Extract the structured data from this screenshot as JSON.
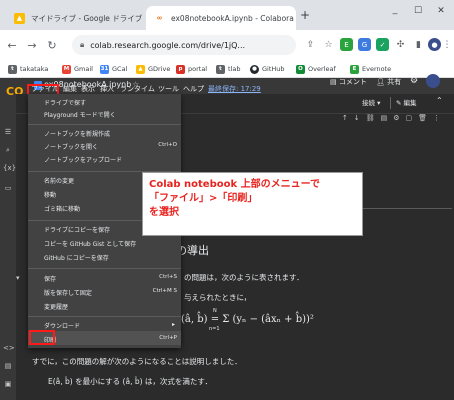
{
  "tabs": [
    {
      "title": "マイドライブ - Google ドライブ",
      "active": false
    },
    {
      "title": "ex08notebookA.ipynb - Colabora",
      "active": true
    }
  ],
  "new_tab": "+",
  "address": {
    "url": "colab.research.google.com/drive/1jQ..."
  },
  "bookmarks": [
    "takataka",
    "Gmail",
    "GCal",
    "GDrive",
    "portal",
    "tlab",
    "GitHub",
    "Overleaf",
    "Evernote"
  ],
  "colab": {
    "logo": "CO",
    "filename": "ex08notebookA.ipynb",
    "menu": [
      "ファイル",
      "編集",
      "表示",
      "挿入",
      "ランタイム",
      "ツール",
      "ヘルプ",
      "最終保存: 17:29"
    ],
    "comment_label": "コメント",
    "share_label": "共有",
    "connect_label": "接続",
    "edit_label": "編集"
  },
  "file_menu": {
    "items": [
      {
        "label": "ドライブで探す",
        "shortcut": ""
      },
      {
        "label": "Playground モードで開く",
        "shortcut": ""
      },
      {
        "label": "ノートブックを新規作成",
        "shortcut": ""
      },
      {
        "label": "ノートブックを開く",
        "shortcut": "Ctrl+O"
      },
      {
        "label": "ノートブックをアップロード",
        "shortcut": ""
      },
      {
        "label": "名前の変更",
        "shortcut": ""
      },
      {
        "label": "移動",
        "shortcut": ""
      },
      {
        "label": "ゴミ箱に移動",
        "shortcut": ""
      },
      {
        "label": "ドライブにコピーを保存",
        "shortcut": ""
      },
      {
        "label": "コピーを GitHub Gist として保存",
        "shortcut": ""
      },
      {
        "label": "GitHub にコピーを保存",
        "shortcut": ""
      },
      {
        "label": "保存",
        "shortcut": "Ctrl+S"
      },
      {
        "label": "版を保存して固定",
        "shortcut": "Ctrl+M S"
      },
      {
        "label": "変更履歴",
        "shortcut": ""
      },
      {
        "label": "ダウンロード",
        "shortcut": ""
      },
      {
        "label": "印刷",
        "shortcut": "Ctrl+P"
      }
    ]
  },
  "callout": {
    "line1": "Colab notebook 上部のメニューで",
    "line2": "「ファイル」>「印刷」",
    "line3": "を選択"
  },
  "content": {
    "heading": "の導出",
    "line1": "の問題は，次のように表されます．",
    "line2": "与えられたときに，",
    "equation": "(â, b̂) = Σ (yₙ − (âxₙ + b̂))²",
    "eq_top": "N",
    "eq_bottom": "n=1",
    "line3": "すでに，この問題の解が次のようになることは説明しました．",
    "line4": "E(â, b̂) を最小にする (â, b̂) は，次式を満たす．"
  },
  "colors": {
    "highlight": "#ff1a1a",
    "callout_text": "#e8231f"
  }
}
